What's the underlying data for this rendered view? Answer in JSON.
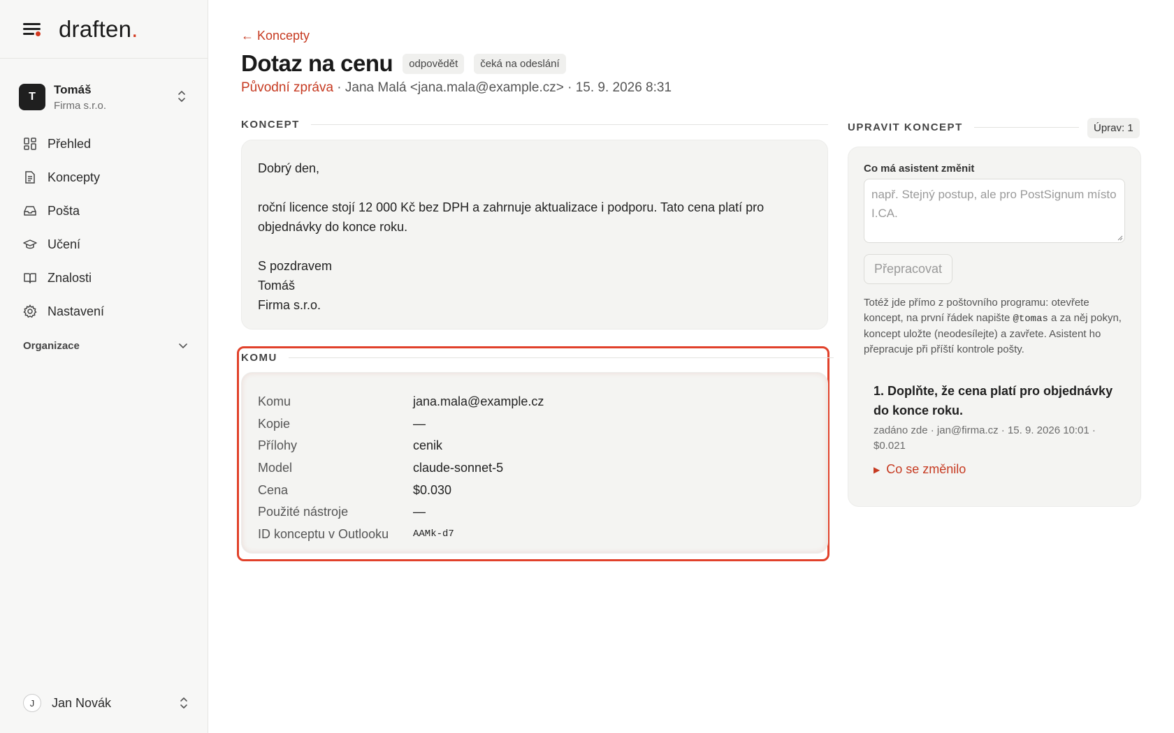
{
  "sidebar": {
    "logo": "draften",
    "logo_dot": ".",
    "org": {
      "initial": "T",
      "name": "Tomáš",
      "sub": "Firma s.r.o."
    },
    "items": [
      {
        "label": "Přehled",
        "icon": "grid-icon"
      },
      {
        "label": "Koncepty",
        "icon": "document-icon"
      },
      {
        "label": "Pošta",
        "icon": "inbox-icon"
      },
      {
        "label": "Učení",
        "icon": "graduation-cap-icon"
      },
      {
        "label": "Znalosti",
        "icon": "book-icon"
      },
      {
        "label": "Nastavení",
        "icon": "gear-icon"
      }
    ],
    "section": "Organizace",
    "user": {
      "initial": "J",
      "name": "Jan Novák"
    }
  },
  "header": {
    "back": "← Koncepty",
    "title": "Dotaz na cenu",
    "badges": [
      "odpovědět",
      "čeká na odeslání"
    ],
    "original_link": "Původní zpráva",
    "meta": " · Jana Malá <jana.mala@example.cz> · 15. 9. 2026 8:31"
  },
  "draft": {
    "label": "KONCEPT",
    "lines": [
      "Dobrý den,",
      "",
      "roční licence stojí 12 000 Kč bez DPH a zahrnuje aktualizace i podporu. Tato cena platí pro objednávky do konce roku.",
      "",
      "S pozdravem",
      "Tomáš",
      "Firma s.r.o."
    ]
  },
  "komu": {
    "label": "KOMU",
    "rows": [
      {
        "key": "Komu",
        "value": "jana.mala@example.cz"
      },
      {
        "key": "Kopie",
        "value": "—"
      },
      {
        "key": "Přílohy",
        "value": "cenik"
      },
      {
        "key": "Model",
        "value": "claude-sonnet-5"
      },
      {
        "key": "Cena",
        "value": "$0.030"
      },
      {
        "key": "Použité nástroje",
        "value": "—"
      },
      {
        "key": "ID konceptu v Outlooku",
        "value": "AAMk-d7"
      }
    ]
  },
  "edit": {
    "label": "UPRAVIT KONCEPT",
    "count": "Úprav: 1",
    "field_label": "Co má asistent změnit",
    "placeholder": "např. Stejný postup, ale pro PostSignum místo I.CA.",
    "button": "Přepracovat",
    "help_before": "Totéž jde přímo z poštovního programu: otevřete koncept, na první řádek napište ",
    "help_code": "@tomas",
    "help_after": " a za něj pokyn, koncept uložte (neodesílejte) a zavřete. Asistent ho přepracuje při příští kontrole pošty.",
    "item": {
      "text": "1. Doplňte, že cena platí pro objednávky do konce roku.",
      "meta": "zadáno zde · jan@firma.cz · 15. 9. 2026 10:01 · $0.021",
      "changed": "Co se změnilo"
    }
  },
  "colors": {
    "accent": "#c63a21",
    "highlight": "#e1412a"
  }
}
